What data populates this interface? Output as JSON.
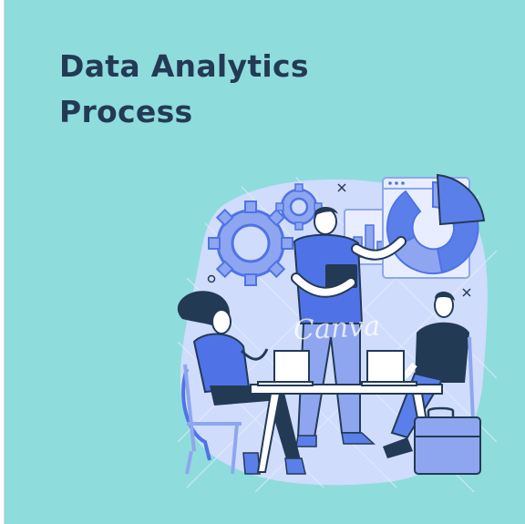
{
  "slide": {
    "title_line1": "Data Analytics",
    "title_line2": "Process",
    "background_color": "#8fdcdc",
    "title_color": "#233a55"
  },
  "illustration": {
    "subject": "team-meeting-analytics",
    "watermark_text": "Canva",
    "accent_color": "#4f73e6",
    "blob_color": "#cfdcfb"
  }
}
